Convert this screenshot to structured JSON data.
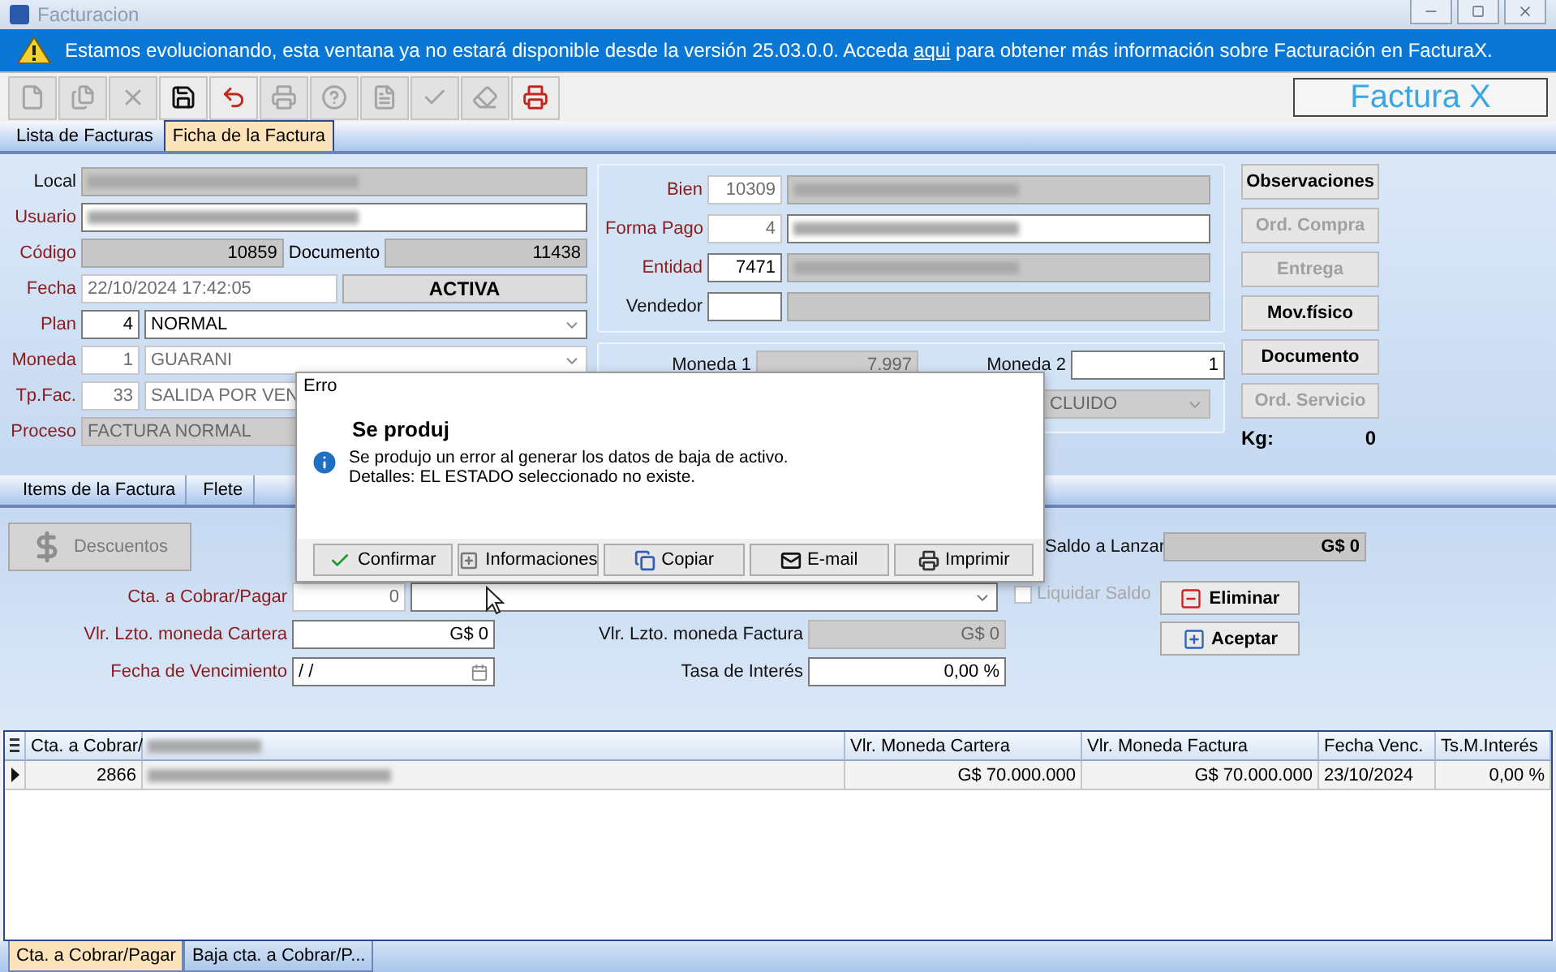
{
  "window": {
    "title": "Facturacion"
  },
  "banner": {
    "before": "Estamos evolucionando, esta ventana ya no estará disponible desde la versión 25.03.0.0. Acceda ",
    "link": "aqui",
    "after": " para obtener más información sobre Facturación en FacturaX."
  },
  "toolbar": [
    {
      "kind": "new",
      "disabled": true
    },
    {
      "kind": "copy",
      "disabled": true
    },
    {
      "kind": "delete",
      "disabled": true
    },
    {
      "kind": "save",
      "disabled": false
    },
    {
      "kind": "undo",
      "disabled": false
    },
    {
      "kind": "print",
      "disabled": true
    },
    {
      "kind": "help",
      "disabled": true
    },
    {
      "kind": "info",
      "disabled": true
    },
    {
      "kind": "check",
      "disabled": true
    },
    {
      "kind": "eraser",
      "disabled": true
    },
    {
      "kind": "fax",
      "disabled": false
    }
  ],
  "logo": {
    "text": "Factura X"
  },
  "tabs": [
    {
      "label": "Lista de Facturas",
      "selected": false
    },
    {
      "label": "Ficha de la Factura",
      "selected": true
    }
  ],
  "left_rows": [
    {
      "label": "Local",
      "required": false,
      "fields": [
        {
          "kind": "text",
          "readonly": true,
          "disabled": false,
          "redacted": true
        }
      ]
    },
    {
      "label": "Usuario",
      "required": true,
      "fields": [
        {
          "kind": "text",
          "readonly": false,
          "disabled": false,
          "redacted": true
        }
      ]
    },
    {
      "label": "Código",
      "required": true,
      "fields": [
        {
          "kind": "number",
          "readonly": true,
          "disabled": false,
          "value": "10859"
        },
        {
          "kind": "caption",
          "value": "Documento"
        },
        {
          "kind": "number",
          "readonly": true,
          "disabled": false,
          "value": "11438"
        }
      ]
    },
    {
      "label": "Fecha",
      "required": true,
      "fields": [
        {
          "kind": "text",
          "readonly": false,
          "disabled": true,
          "value": "22/10/2024 17:42:05"
        },
        {
          "kind": "status",
          "value": "ACTIVA"
        }
      ]
    },
    {
      "label": "Plan",
      "required": true,
      "fields": [
        {
          "kind": "code",
          "readonly": false,
          "disabled": false,
          "value": "4"
        },
        {
          "kind": "select",
          "readonly": false,
          "disabled": false,
          "value": "NORMAL"
        }
      ]
    },
    {
      "label": "Moneda",
      "required": true,
      "fields": [
        {
          "kind": "code",
          "readonly": false,
          "disabled": true,
          "value": "1"
        },
        {
          "kind": "select",
          "readonly": false,
          "disabled": true,
          "value": "GUARANI"
        }
      ]
    },
    {
      "label": "Tp.Fac.",
      "required": true,
      "fields": [
        {
          "kind": "code",
          "readonly": false,
          "disabled": true,
          "value": "33"
        },
        {
          "kind": "text",
          "readonly": false,
          "disabled": true,
          "value": "SALIDA POR VEN"
        }
      ]
    },
    {
      "label": "Proceso",
      "required": true,
      "fields": [
        {
          "kind": "text",
          "readonly": true,
          "disabled": true,
          "value": "FACTURA NORMAL"
        }
      ]
    }
  ],
  "middle_rows": [
    {
      "label": "Bien",
      "required": true,
      "fields": [
        {
          "kind": "code",
          "readonly": false,
          "disabled": true,
          "value": "10309"
        },
        {
          "kind": "text",
          "readonly": true,
          "disabled": false,
          "redacted": true
        }
      ]
    },
    {
      "label": "Forma Pago",
      "required": true,
      "fields": [
        {
          "kind": "code",
          "readonly": false,
          "disabled": true,
          "value": "4"
        },
        {
          "kind": "text",
          "readonly": false,
          "disabled": false,
          "redacted": true
        }
      ]
    },
    {
      "label": "Entidad",
      "required": true,
      "fields": [
        {
          "kind": "code",
          "readonly": false,
          "disabled": false,
          "value": "7471"
        },
        {
          "kind": "text",
          "readonly": true,
          "disabled": false,
          "redacted": true
        }
      ]
    },
    {
      "label": "Vendedor",
      "required": false,
      "fields": [
        {
          "kind": "code",
          "readonly": false,
          "disabled": false
        },
        {
          "kind": "text",
          "readonly": true,
          "disabled": false
        }
      ]
    }
  ],
  "currency": {
    "moneda1": {
      "label": "Moneda 1",
      "value": "7.997"
    },
    "moneda2": {
      "label": "Moneda 2",
      "value": "1"
    },
    "select": {
      "value": "CLUIDO"
    }
  },
  "side_buttons": [
    {
      "label": "Observaciones",
      "disabled": false
    },
    {
      "label": "Ord. Compra",
      "disabled": true
    },
    {
      "label": "Entrega",
      "disabled": true
    },
    {
      "label": "Mov.físico",
      "disabled": false
    },
    {
      "label": "Documento",
      "disabled": false
    },
    {
      "label": "Ord. Servicio",
      "disabled": true
    }
  ],
  "kg": {
    "label": "Kg:",
    "value": "0"
  },
  "sub_tabs": [
    {
      "label": "Items de la Factura",
      "selected": false
    },
    {
      "label": "Flete",
      "selected": false
    }
  ],
  "lower": {
    "discount_button": {
      "label": "Descuentos",
      "disabled": true
    },
    "saldo": {
      "label": "Saldo a Lanzar",
      "value": "G$ 0"
    },
    "cta": {
      "label": "Cta. a Cobrar/Pagar",
      "required": true,
      "value": "0"
    },
    "liquidar": {
      "label": "Liquidar Saldo",
      "checked": false,
      "disabled": true
    },
    "cartera": {
      "label": "Vlr. Lzto. moneda Cartera",
      "required": true,
      "value": "G$ 0"
    },
    "factura": {
      "label": "Vlr. Lzto. moneda Factura",
      "required": false,
      "value": "G$ 0"
    },
    "vencimiento": {
      "label": "Fecha de Vencimiento",
      "required": true,
      "value": "/ /"
    },
    "tasa": {
      "label": "Tasa de Interés",
      "required": false,
      "value": "0,00 %"
    },
    "actions": [
      {
        "kind": "remove",
        "label": "Eliminar"
      },
      {
        "kind": "add",
        "label": "Aceptar"
      }
    ]
  },
  "grid": {
    "columns": [
      {
        "label": "Cta. a Cobrar/"
      },
      {
        "redacted": true
      },
      {
        "label": "Vlr. Moneda Cartera"
      },
      {
        "label": "Vlr. Moneda Factura"
      },
      {
        "label": "Fecha Venc."
      },
      {
        "label": "Ts.M.Interés"
      }
    ],
    "rows": [
      {
        "current": true,
        "cells": [
          {
            "value": "2866"
          },
          {
            "redacted": true
          },
          {
            "value": "G$ 70.000.000"
          },
          {
            "value": "G$ 70.000.000"
          },
          {
            "value": "23/10/2024"
          },
          {
            "value": "0,00 %"
          }
        ]
      }
    ]
  },
  "bottom_tabs": [
    {
      "label": "Cta. a Cobrar/Pagar",
      "selected": true
    },
    {
      "label": "Baja cta. a Cobrar/P...",
      "selected": false
    }
  ],
  "dialog": {
    "title": "Erro",
    "heading": "Se produj",
    "lines": [
      "Se produjo un error al generar los datos de baja de activo.",
      "Detalles: EL ESTADO seleccionado no existe."
    ],
    "buttons": [
      {
        "kind": "confirm",
        "label": "Confirmar"
      },
      {
        "kind": "details",
        "label": "Informaciones"
      },
      {
        "kind": "copy",
        "label": "Copiar"
      },
      {
        "kind": "mail",
        "label": "E-mail"
      },
      {
        "kind": "print",
        "label": "Imprimir"
      }
    ]
  }
}
